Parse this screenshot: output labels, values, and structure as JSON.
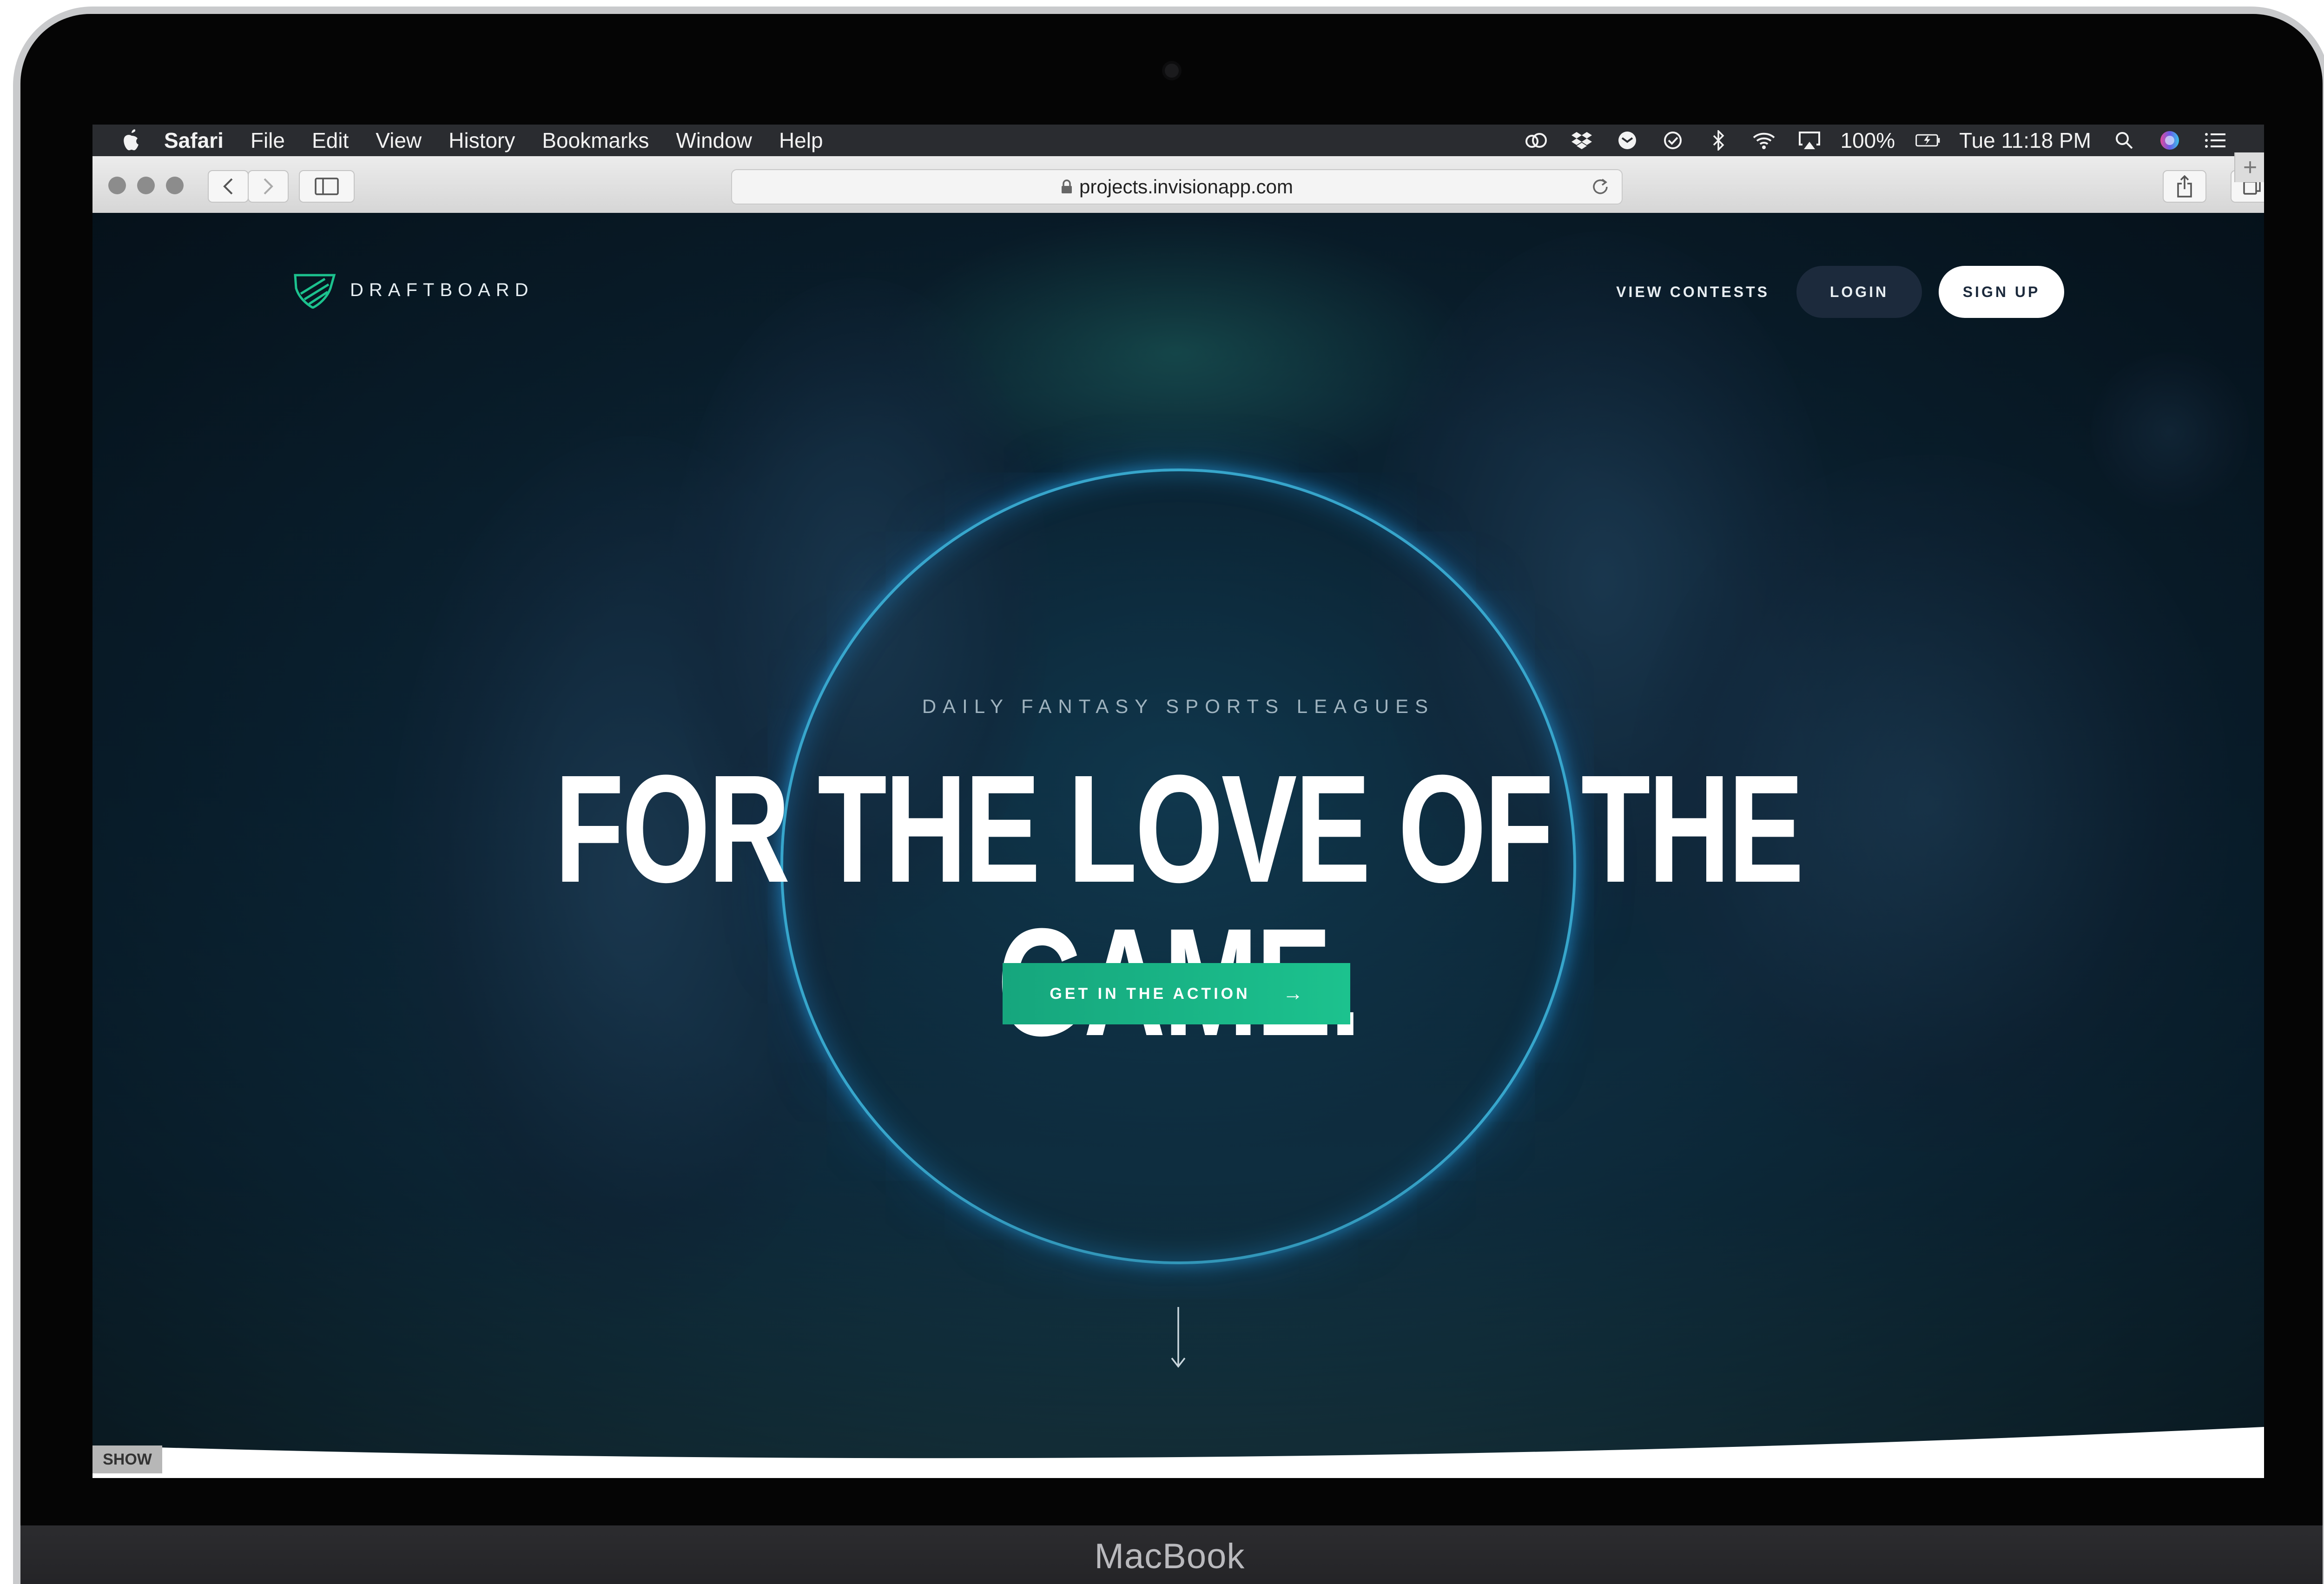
{
  "menubar": {
    "app_name": "Safari",
    "items": [
      "File",
      "Edit",
      "View",
      "History",
      "Bookmarks",
      "Window",
      "Help"
    ],
    "battery": "100%",
    "clock": "Tue 11:18 PM",
    "status_icons": [
      "creative-cloud-icon",
      "dropbox-icon",
      "app-icon",
      "checkmark-icon",
      "bluetooth-icon",
      "wifi-icon",
      "airplay-icon",
      "battery-icon",
      "spotlight-icon",
      "siri-icon",
      "notification-center-icon"
    ]
  },
  "browser": {
    "url": "projects.invisionapp.com"
  },
  "page": {
    "brand": "DRAFTBOARD",
    "nav": {
      "view_contests": "VIEW CONTESTS",
      "login": "LOGIN",
      "signup": "SIGN UP"
    },
    "eyebrow": "DAILY FANTASY SPORTS LEAGUES",
    "headline": "FOR THE LOVE OF THE GAME.",
    "cta": "GET IN THE ACTION",
    "cta_arrow": "→",
    "accent_color": "#1cc28e"
  },
  "invision": {
    "show_label": "SHOW"
  },
  "device": {
    "label": "MacBook"
  }
}
